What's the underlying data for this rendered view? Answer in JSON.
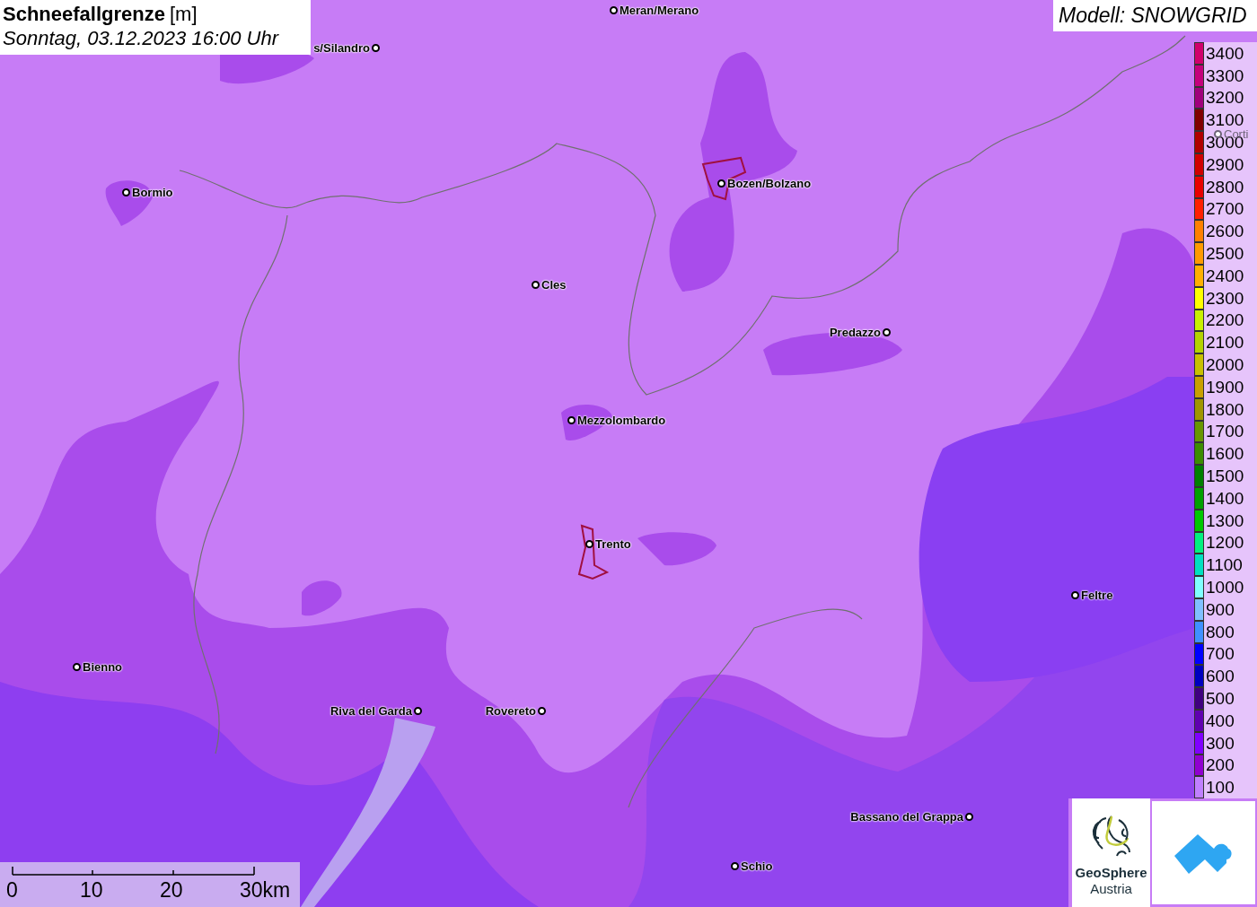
{
  "title": {
    "variable": "Schneefallgrenze",
    "unit": "[m]",
    "datetime": "Sonntag, 03.12.2023 16:00 Uhr"
  },
  "model": "Modell: SNOWGRID",
  "cities": [
    {
      "name": "Meran/Merano",
      "kind": "town"
    },
    {
      "name": "s/Silandro",
      "kind": "town"
    },
    {
      "name": "Bormio",
      "kind": "town"
    },
    {
      "name": "Bozen/Bolzano",
      "kind": "town"
    },
    {
      "name": "Cles",
      "kind": "town"
    },
    {
      "name": "Predazzo",
      "kind": "town"
    },
    {
      "name": "Mezzolombardo",
      "kind": "town"
    },
    {
      "name": "Trento",
      "kind": "town"
    },
    {
      "name": "Feltre",
      "kind": "town"
    },
    {
      "name": "Bienno",
      "kind": "town"
    },
    {
      "name": "Riva del Garda",
      "kind": "town"
    },
    {
      "name": "Rovereto",
      "kind": "town"
    },
    {
      "name": "Bassano del Grappa",
      "kind": "town"
    },
    {
      "name": "Schio",
      "kind": "town"
    },
    {
      "name": "Corti",
      "kind": "faded"
    }
  ],
  "legend": [
    {
      "label": "3400",
      "color": "#d0006c"
    },
    {
      "label": "3300",
      "color": "#c4007c"
    },
    {
      "label": "3200",
      "color": "#a0007c"
    },
    {
      "label": "3100",
      "color": "#800000"
    },
    {
      "label": "3000",
      "color": "#b00000"
    },
    {
      "label": "2900",
      "color": "#d00000"
    },
    {
      "label": "2800",
      "color": "#e80000"
    },
    {
      "label": "2700",
      "color": "#ff2000"
    },
    {
      "label": "2600",
      "color": "#ff8000"
    },
    {
      "label": "2500",
      "color": "#ff9a00"
    },
    {
      "label": "2400",
      "color": "#ffb000"
    },
    {
      "label": "2300",
      "color": "#ffff00"
    },
    {
      "label": "2200",
      "color": "#c8f000"
    },
    {
      "label": "2100",
      "color": "#b4d200"
    },
    {
      "label": "2000",
      "color": "#c8c000"
    },
    {
      "label": "1900",
      "color": "#c8a000"
    },
    {
      "label": "1800",
      "color": "#a09600"
    },
    {
      "label": "1700",
      "color": "#689600"
    },
    {
      "label": "1600",
      "color": "#3c8c00"
    },
    {
      "label": "1500",
      "color": "#008000"
    },
    {
      "label": "1400",
      "color": "#00a000"
    },
    {
      "label": "1300",
      "color": "#00c800"
    },
    {
      "label": "1200",
      "color": "#00f080"
    },
    {
      "label": "1100",
      "color": "#00e0c0"
    },
    {
      "label": "1000",
      "color": "#80ffff"
    },
    {
      "label": "900",
      "color": "#80c0ff"
    },
    {
      "label": "800",
      "color": "#4090ff"
    },
    {
      "label": "700",
      "color": "#0000ff"
    },
    {
      "label": "600",
      "color": "#0000c0"
    },
    {
      "label": "500",
      "color": "#400080"
    },
    {
      "label": "400",
      "color": "#6000b0"
    },
    {
      "label": "300",
      "color": "#8000ff"
    },
    {
      "label": "200",
      "color": "#9000d0"
    },
    {
      "label": "100",
      "color": "#c080ff"
    }
  ],
  "scale_bar": {
    "ticks": [
      "0",
      "10",
      "20",
      "30km"
    ]
  },
  "logo": {
    "name": "GeoSphere",
    "sub": "Austria"
  }
}
